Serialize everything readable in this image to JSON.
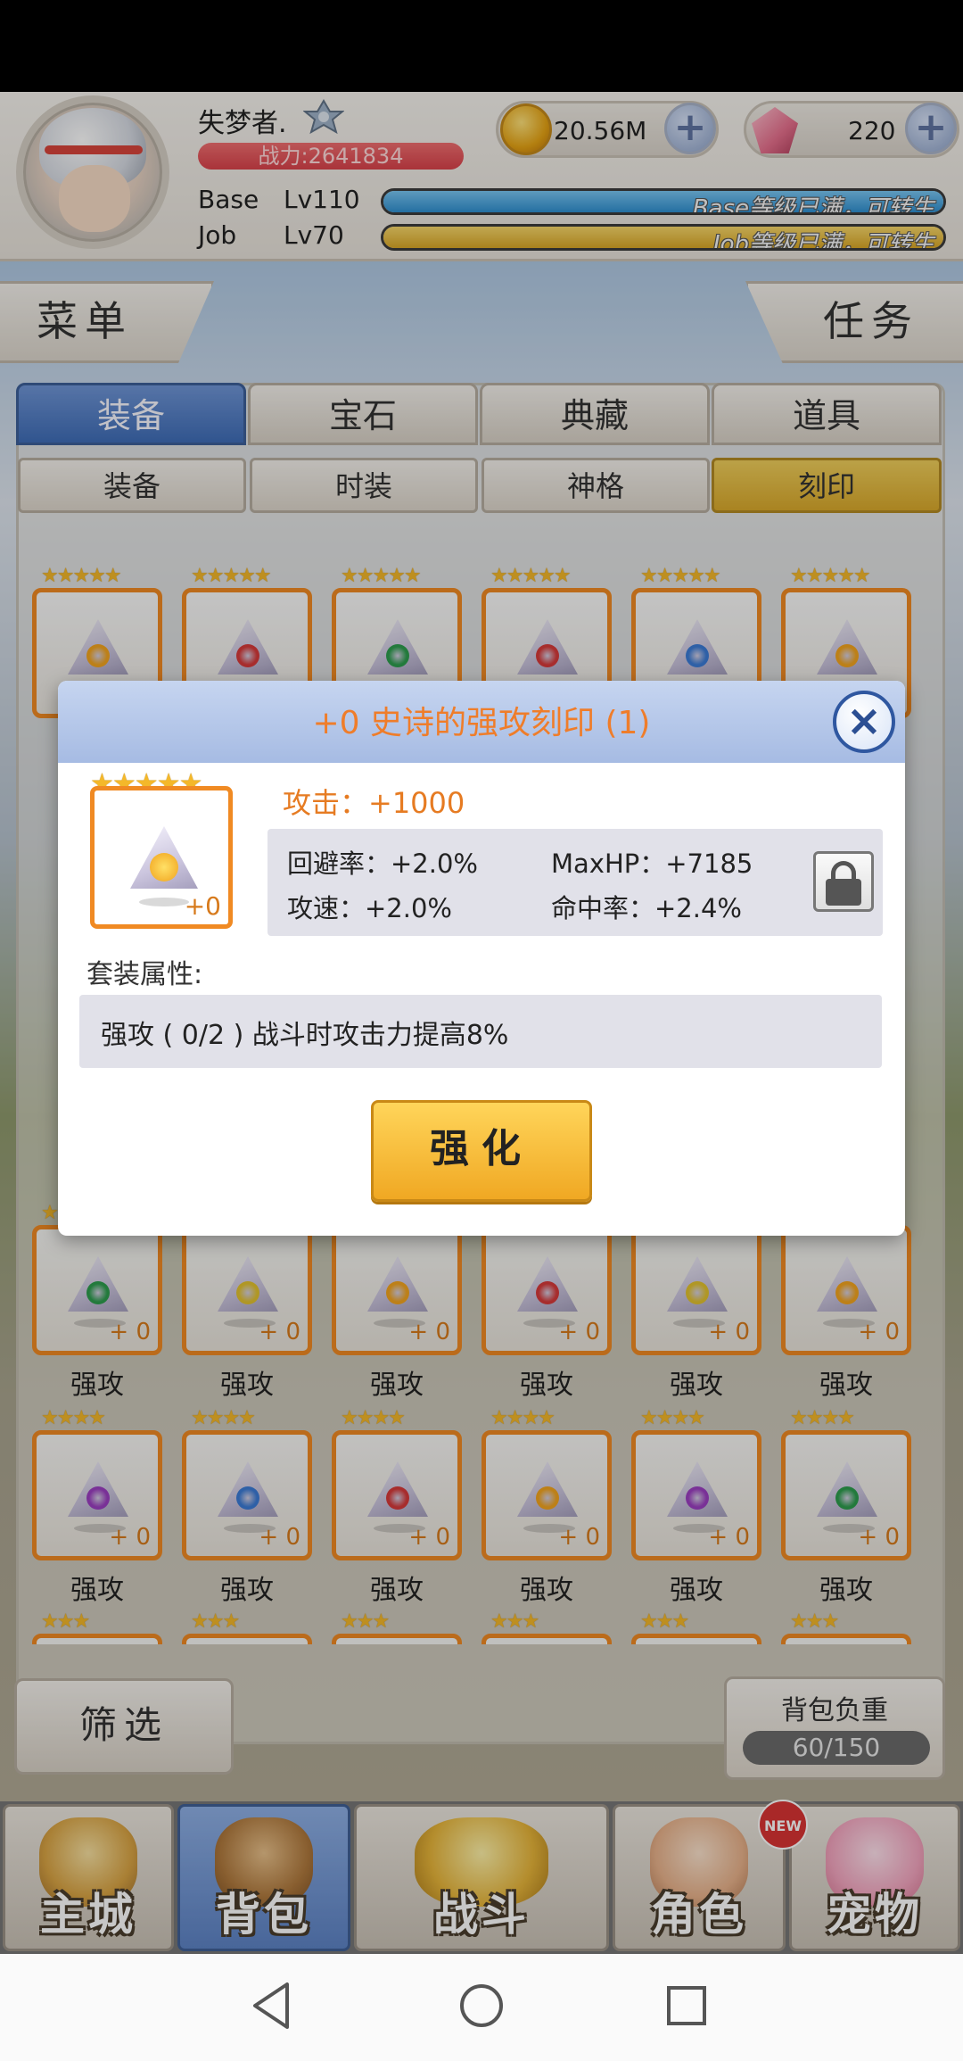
{
  "player": {
    "name": "失梦者.",
    "power": "战力:2641834",
    "base_label": "Base",
    "base_level": "Lv110",
    "base_status": "Base等级已满，可转生",
    "base_fill": 1.0,
    "job_label": "Job",
    "job_level": "Lv70",
    "job_status": "Job等级已满，可转生",
    "job_fill": 1.0
  },
  "currency": {
    "gold": "20.56M",
    "gems": "220"
  },
  "banners": {
    "menu": "菜单",
    "task": "任务"
  },
  "tabs": [
    {
      "label": "装备",
      "active": true
    },
    {
      "label": "宝石",
      "active": false
    },
    {
      "label": "典藏",
      "active": false
    },
    {
      "label": "道具",
      "active": false
    }
  ],
  "subtabs": [
    {
      "label": "装备",
      "active": false
    },
    {
      "label": "时装",
      "active": false
    },
    {
      "label": "神格",
      "active": false
    },
    {
      "label": "刻印",
      "active": true
    }
  ],
  "grid": {
    "rows": [
      {
        "stars": "★★★★★",
        "items": [
          {
            "core": "sun",
            "level": "",
            "name": ""
          },
          {
            "core": "fire",
            "level": "",
            "name": ""
          },
          {
            "core": "wind",
            "level": "",
            "name": ""
          },
          {
            "core": "fire",
            "level": "",
            "name": ""
          },
          {
            "core": "water",
            "level": "",
            "name": ""
          },
          {
            "core": "sun",
            "level": "",
            "name": ""
          }
        ]
      },
      {
        "stars": "★★★★",
        "items": [
          {
            "core": "wind",
            "level": "+ 0",
            "name": "强攻"
          },
          {
            "core": "earth",
            "level": "+ 0",
            "name": "强攻"
          },
          {
            "core": "sun",
            "level": "+ 0",
            "name": "强攻"
          },
          {
            "core": "fire",
            "level": "+ 0",
            "name": "强攻"
          },
          {
            "core": "earth",
            "level": "+ 0",
            "name": "强攻"
          },
          {
            "core": "sun",
            "level": "+ 0",
            "name": "强攻"
          }
        ]
      },
      {
        "stars": "★★★★",
        "items": [
          {
            "core": "moon",
            "level": "+ 0",
            "name": "强攻"
          },
          {
            "core": "water",
            "level": "+ 0",
            "name": "强攻"
          },
          {
            "core": "fire",
            "level": "+ 0",
            "name": "强攻"
          },
          {
            "core": "sun",
            "level": "+ 0",
            "name": "强攻"
          },
          {
            "core": "moon",
            "level": "+ 0",
            "name": "强攻"
          },
          {
            "core": "wind",
            "level": "+ 0",
            "name": "强攻"
          }
        ]
      },
      {
        "stars": "★★★",
        "items": [
          {
            "core": "",
            "level": "",
            "name": ""
          },
          {
            "core": "",
            "level": "",
            "name": ""
          },
          {
            "core": "",
            "level": "",
            "name": ""
          },
          {
            "core": "",
            "level": "",
            "name": ""
          },
          {
            "core": "",
            "level": "",
            "name": ""
          },
          {
            "core": "",
            "level": "",
            "name": ""
          }
        ]
      }
    ]
  },
  "core_colors": {
    "sun": "#f2a41f",
    "fire": "#d63a3a",
    "wind": "#2d9d4e",
    "water": "#3b7bd6",
    "moon": "#9c3fc2",
    "earth": "#e2c230"
  },
  "filter_label": "筛选",
  "weight": {
    "label": "背包负重",
    "value": "60/150"
  },
  "nav": [
    {
      "label": "主城",
      "active": false
    },
    {
      "label": "背包",
      "active": true
    },
    {
      "label": "战斗",
      "active": false
    },
    {
      "label": "角色",
      "active": false
    },
    {
      "label": "宠物",
      "active": false
    }
  ],
  "new_badge": "NEW",
  "dialog": {
    "title": "+0 史诗的强攻刻印 (1)",
    "close_icon": "×",
    "stars": "★★★★★",
    "item_level": "+0",
    "main_attr": "攻击：+1000",
    "attrs": [
      "回避率：+2.0%",
      "MaxHP：+7185",
      "攻速：+2.0%",
      "命中率：+2.4%"
    ],
    "set_label": "套装属性:",
    "set_text": "强攻 ( 0/2 ) 战斗时攻击力提高8%",
    "enhance_label": "强化"
  }
}
